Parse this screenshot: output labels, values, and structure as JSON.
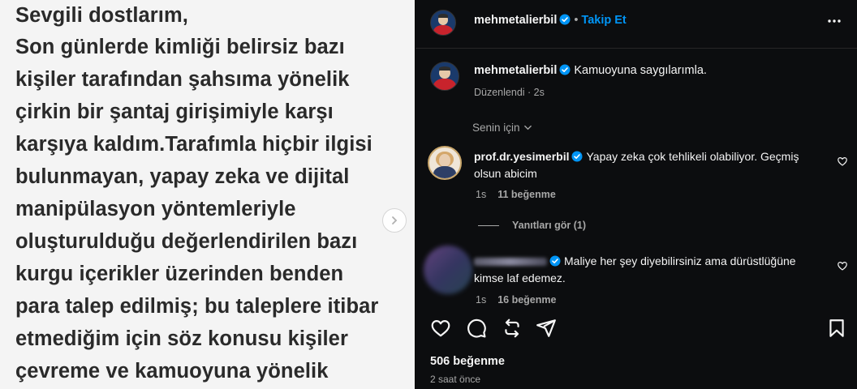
{
  "post_image": {
    "lines": [
      "Sevgili dostlarım,",
      "Son günlerde kimliği belirsiz bazı",
      "kişiler tarafından şahsıma yönelik",
      "çirkin bir şantaj girişimiyle karşı",
      "karşıya kaldım.Tarafımla hiçbir ilgisi",
      "bulunmayan, yapay zeka ve dijital",
      "manipülasyon yöntemleriyle",
      "oluşturulduğu değerlendirilen bazı",
      "kurgu içerikler üzerinden benden",
      "para talep edilmiş; bu taleplere itibar",
      "etmediğim için söz konusu kişiler",
      "çevreme ve kamuoyuna yönelik"
    ]
  },
  "header": {
    "username": "mehmetalierbil",
    "separator": "•",
    "follow_label": "Takip Et"
  },
  "caption": {
    "username": "mehmetalierbil",
    "text": "Kamuoyuna saygılarımla.",
    "meta": "Düzenlendi · 2s"
  },
  "sort_label": "Senin için",
  "comments": [
    {
      "username": "prof.dr.yesimerbil",
      "text_line1": "Yapay zeka çok tehlikeli olabiliyor. Geçmiş",
      "text_line2": "olsun abicim",
      "time": "1s",
      "likes": "11 beğenme",
      "replies": "Yanıtları gör (1)"
    },
    {
      "text_line1": "Maliye her şey diyebilirsiniz ama dürüstlüğüne",
      "text_line2": "kimse laf edemez.",
      "time": "1s",
      "likes": "16 beğenme"
    }
  ],
  "footer": {
    "likes": "506 beğenme",
    "time": "2 saat önce"
  },
  "colors": {
    "background": "#0c0d0f",
    "accent_blue": "#0095f6",
    "muted": "#a8a8a8",
    "image_bg": "#f4f4f4"
  },
  "icons": [
    "verified-badge-icon",
    "more-icon",
    "chevron-down-icon",
    "heart-icon",
    "comment-icon",
    "repost-icon",
    "share-icon",
    "bookmark-icon",
    "chevron-right-icon"
  ]
}
